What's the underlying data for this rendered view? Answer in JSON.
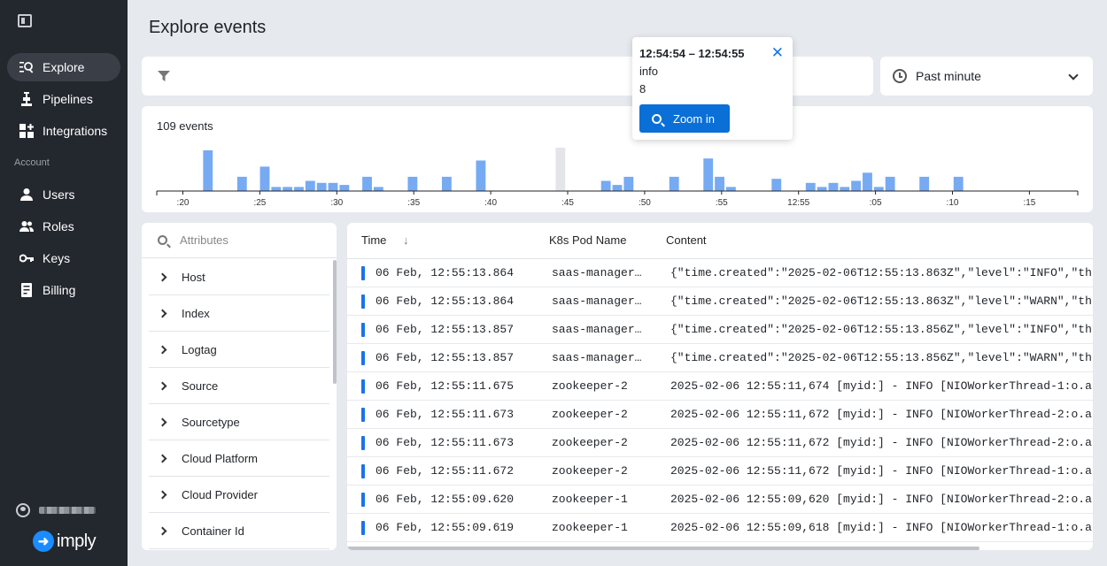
{
  "sidebar": {
    "toggle_icon": "sidebar-toggle-icon",
    "items": [
      {
        "label": "Explore",
        "icon": "explore-icon",
        "active": true
      },
      {
        "label": "Pipelines",
        "icon": "pipelines-icon"
      },
      {
        "label": "Integrations",
        "icon": "integrations-icon"
      }
    ],
    "section_label": "Account",
    "account_items": [
      {
        "label": "Users",
        "icon": "user-icon"
      },
      {
        "label": "Roles",
        "icon": "roles-icon"
      },
      {
        "label": "Keys",
        "icon": "key-icon"
      },
      {
        "label": "Billing",
        "icon": "billing-icon"
      }
    ],
    "logo_text": "imply"
  },
  "header": {
    "title": "Explore events"
  },
  "time_range": {
    "label": "Past minute"
  },
  "chart": {
    "event_count": "109 events"
  },
  "chart_data": {
    "type": "bar",
    "x_ticks": [
      ":20",
      ":25",
      ":30",
      ":35",
      ":40",
      ":45",
      ":50",
      ":55",
      "12:55",
      ":05",
      ":10",
      ":15"
    ],
    "values": [
      0,
      0,
      0,
      0,
      10,
      0,
      0,
      3.5,
      0,
      6,
      1,
      1,
      1,
      2.5,
      2,
      2,
      1.5,
      0,
      3.5,
      1,
      0,
      0,
      3.5,
      0,
      0,
      3.5,
      0,
      0,
      7.5,
      0,
      0,
      0,
      0,
      0,
      0,
      0,
      0,
      0,
      0,
      2.5,
      1.5,
      3.5,
      0,
      0,
      0,
      3.5,
      0,
      0,
      8,
      3.5,
      1,
      0,
      0,
      0,
      3,
      0,
      0,
      2,
      1,
      2,
      1,
      2.5,
      4.5,
      1,
      3.5,
      0,
      0,
      3.5,
      0,
      0,
      3.5,
      0,
      0,
      0,
      0,
      0,
      0,
      0,
      0,
      0,
      0
    ],
    "max_value": 10,
    "highlighted_bar": 35,
    "colors": {
      "bar": "#76aaf3",
      "highlight_bg": "#e3e5e8",
      "axis": "#222222"
    }
  },
  "tooltip": {
    "range": "12:54:54 – 12:54:55",
    "level": "info",
    "count": "8",
    "zoom_label": "Zoom in"
  },
  "attributes": {
    "placeholder": "Attributes",
    "items": [
      "Host",
      "Index",
      "Logtag",
      "Source",
      "Sourcetype",
      "Cloud Platform",
      "Cloud Provider",
      "Container Id"
    ]
  },
  "table": {
    "columns": {
      "time": "Time",
      "pod": "K8s Pod Name",
      "content": "Content"
    },
    "rows": [
      {
        "time": "06 Feb, 12:55:13.864",
        "pod": "saas-manager…",
        "content": "{\"time.created\":\"2025-02-06T12:55:13.863Z\",\"level\":\"INFO\",\"threa"
      },
      {
        "time": "06 Feb, 12:55:13.864",
        "pod": "saas-manager…",
        "content": "{\"time.created\":\"2025-02-06T12:55:13.863Z\",\"level\":\"WARN\",\"threa"
      },
      {
        "time": "06 Feb, 12:55:13.857",
        "pod": "saas-manager…",
        "content": "{\"time.created\":\"2025-02-06T12:55:13.856Z\",\"level\":\"INFO\",\"threa"
      },
      {
        "time": "06 Feb, 12:55:13.857",
        "pod": "saas-manager…",
        "content": "{\"time.created\":\"2025-02-06T12:55:13.856Z\",\"level\":\"WARN\",\"threa"
      },
      {
        "time": "06 Feb, 12:55:11.675",
        "pod": "zookeeper-2",
        "content": "2025-02-06 12:55:11,674 [myid:] - INFO [NIOWorkerThread-1:o.a.z."
      },
      {
        "time": "06 Feb, 12:55:11.673",
        "pod": "zookeeper-2",
        "content": "2025-02-06 12:55:11,672 [myid:] - INFO [NIOWorkerThread-2:o.a.z."
      },
      {
        "time": "06 Feb, 12:55:11.673",
        "pod": "zookeeper-2",
        "content": "2025-02-06 12:55:11,672 [myid:] - INFO [NIOWorkerThread-2:o.a.z."
      },
      {
        "time": "06 Feb, 12:55:11.672",
        "pod": "zookeeper-2",
        "content": "2025-02-06 12:55:11,672 [myid:] - INFO [NIOWorkerThread-1:o.a.z."
      },
      {
        "time": "06 Feb, 12:55:09.620",
        "pod": "zookeeper-1",
        "content": "2025-02-06 12:55:09,620 [myid:] - INFO [NIOWorkerThread-2:o.a.z."
      },
      {
        "time": "06 Feb, 12:55:09.619",
        "pod": "zookeeper-1",
        "content": "2025-02-06 12:55:09,618 [myid:] - INFO [NIOWorkerThread-1:o.a.z."
      }
    ]
  }
}
